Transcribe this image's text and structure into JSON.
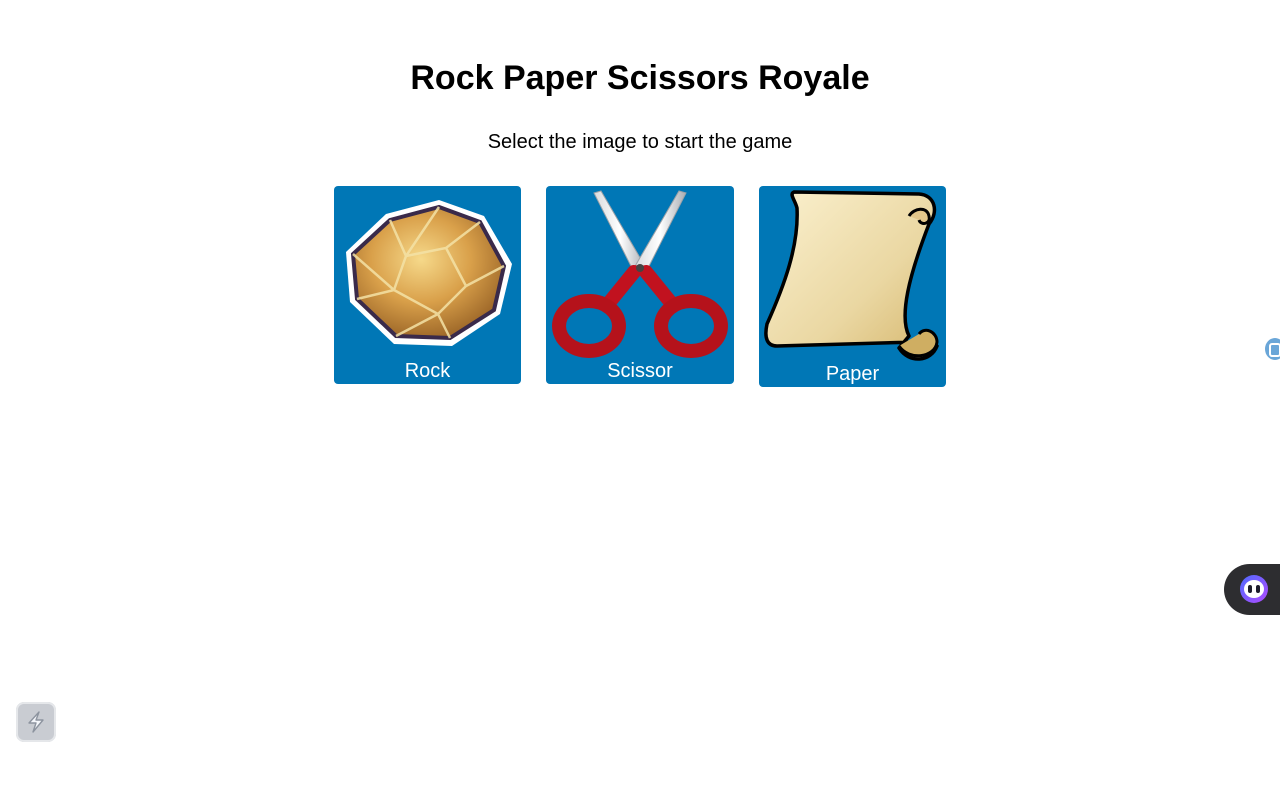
{
  "page": {
    "title": "Rock Paper Scissors Royale",
    "instructions": "Select the image to start the game"
  },
  "choices": [
    {
      "id": "rock",
      "label": "Rock",
      "icon": "rock-icon"
    },
    {
      "id": "scissor",
      "label": "Scissor",
      "icon": "scissors-icon"
    },
    {
      "id": "paper",
      "label": "Paper",
      "icon": "scroll-icon"
    }
  ],
  "overlays": {
    "side_icon": "extension-icon",
    "assistant_icon": "assistant-face-icon",
    "widget_icon": "lightning-icon"
  },
  "colors": {
    "card_background": "#0077b6",
    "card_label": "#ffffff",
    "assistant_pill": "#2d2d30"
  }
}
